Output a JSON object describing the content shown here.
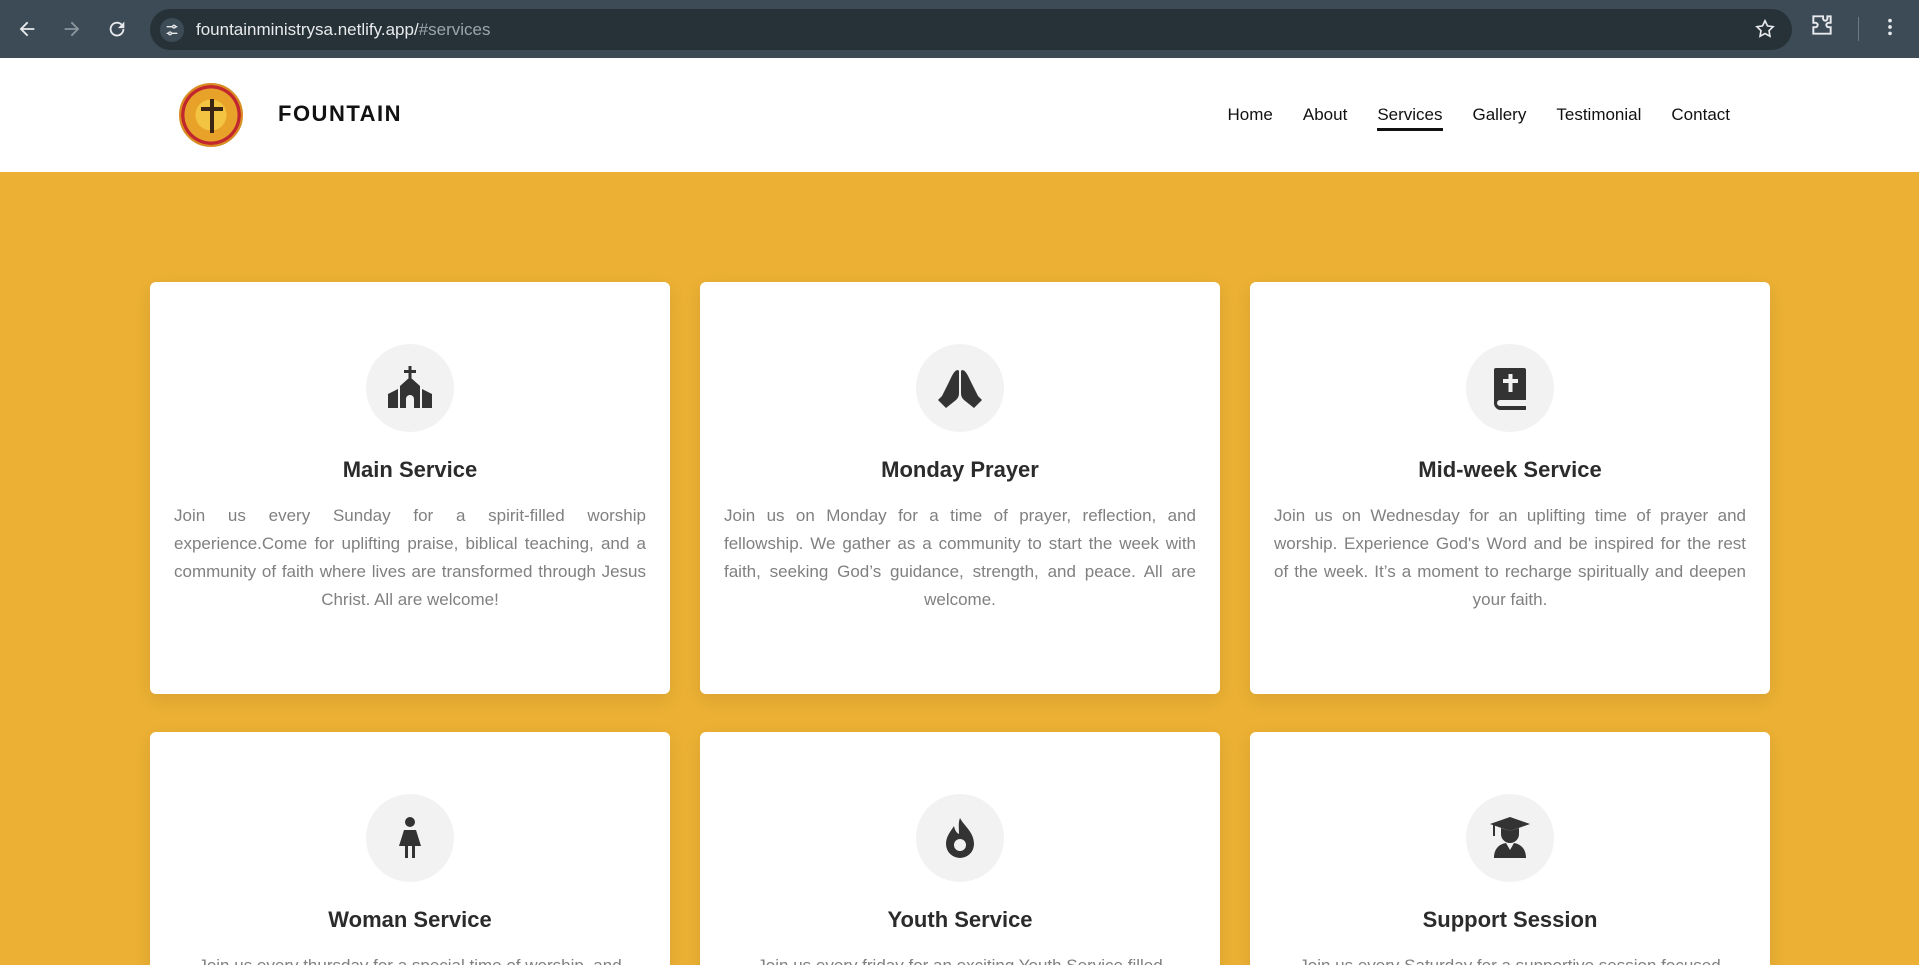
{
  "browser": {
    "url_host": "fountainministrysa.netlify.app/",
    "url_path": "#services"
  },
  "site": {
    "brand": "FOUNTAIN",
    "nav": [
      "Home",
      "About",
      "Services",
      "Gallery",
      "Testimonial",
      "Contact"
    ],
    "active_nav": "Services"
  },
  "colors": {
    "section_background": "#ebb034",
    "card_background": "#ffffff",
    "icon_circle": "#f2f2f2"
  },
  "services": [
    {
      "icon": "church-icon",
      "title": "Main Service",
      "description": "Join us every Sunday for a spirit-filled worship experience.Come for uplifting praise, biblical teaching, and a community of faith where lives are transformed through Jesus Christ. All are welcome!"
    },
    {
      "icon": "praying-hands-icon",
      "title": "Monday Prayer",
      "description": "Join us on Monday for a time of prayer, reflection, and fellowship. We gather as a community to start the week with faith, seeking God’s guidance, strength, and peace. All are welcome."
    },
    {
      "icon": "bible-icon",
      "title": "Mid-week Service",
      "description": "Join us on Wednesday for an uplifting time of prayer and worship. Experience God's Word and be inspired for the rest of the week. It’s a moment to recharge spiritually and deepen your faith."
    },
    {
      "icon": "woman-icon",
      "title": "Woman Service",
      "description": "Join us every thursday for a special time of worship, and"
    },
    {
      "icon": "fire-icon",
      "title": "Youth Service",
      "description": "Join us every friday for an exciting Youth Service filled"
    },
    {
      "icon": "graduate-icon",
      "title": "Support Session",
      "description": "Join us every Saturday for a supportive session focused"
    }
  ]
}
